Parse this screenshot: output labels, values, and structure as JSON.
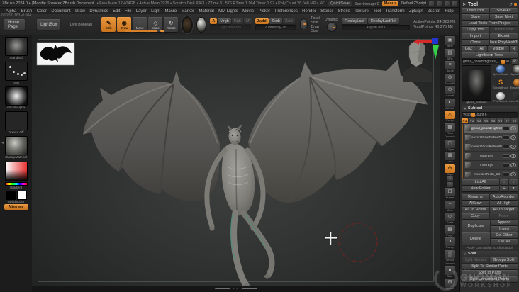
{
  "app": {
    "title": "ZBrush 2024.0.4 [Maddie Spencer]ZBrush Document",
    "stats": "• Free Mem 12.404GB • Active Mem 3979 • Scratch Disk 4363 • ZTime 51.576 RTime 1.964 Timer 1.97 • PolyCount 26.048 MP • MeshCount 5 Movie 180/57mb",
    "ac": "AC",
    "quicksave": "QuickSave",
    "see_through": "See-through 0",
    "menus_btn": "Menus",
    "zscript": "DefaultZScript"
  },
  "menu_bar": {
    "items": [
      "Alpha",
      "Brush",
      "Color",
      "Document",
      "Draw",
      "Dynamics",
      "Edit",
      "File",
      "Layer",
      "Light",
      "Macro",
      "Marker",
      "Material",
      "MM Lights",
      "Movie",
      "Picker",
      "Preferences",
      "Render",
      "Stencil",
      "Stroke",
      "Texture",
      "Tool",
      "Transform",
      "Zplugin",
      "Zscript",
      "Help"
    ]
  },
  "coords_readout": "0.928 0.163 -0.004",
  "top_shelf": {
    "home_page": "Home Page",
    "lightbox": "LightBox",
    "live_boolean": "Live Boolean",
    "modes": [
      {
        "label": "Edit",
        "glyph": "✎",
        "active": true
      },
      {
        "label": "Draw",
        "glyph": "◉",
        "active": true
      },
      {
        "label": "Move",
        "glyph": "+"
      },
      {
        "label": "Scale",
        "glyph": "◇"
      },
      {
        "label": "Rotate",
        "glyph": "↻"
      }
    ],
    "paint_buttons": [
      {
        "label": "A",
        "active": true
      },
      {
        "label": "Mrgb"
      },
      {
        "label": "Rgb",
        "dim": true
      },
      {
        "label": "M",
        "dim": true
      }
    ],
    "rgb_intensity": "Rgb Intensity",
    "sculpt_buttons": [
      {
        "label": "Zadd",
        "active": true
      },
      {
        "label": "Zsub"
      },
      {
        "label": "Zcut",
        "dim": true
      }
    ],
    "z_intensity": "Z Intensity 25",
    "focal_shift": "Focal Shift",
    "draw_size": "Draw Size",
    "dynamic_label": "Dynamic",
    "replay_last": "ReplayLast",
    "replay_last_rel": "ReplayLastRel",
    "adjust_last": "AdjustLast 1",
    "active_points": "ActivePoints: 24.323 Mil",
    "total_points": "TotalPoints: 46.275 Mil"
  },
  "left_shelf": {
    "items": [
      {
        "label": "Standard",
        "cls": "th-standard"
      },
      {
        "label": "Dots",
        "cls": "th-dots"
      },
      {
        "label": "xBrushAlpha",
        "cls": "th-alpha"
      },
      {
        "label": "Texture Off",
        "cls": "th-texture"
      },
      {
        "label": "StartupMaterial",
        "cls": "th-material"
      }
    ],
    "gradient_label": "Gradient",
    "switch_color": "SwitchColor",
    "alternate": "Alternate"
  },
  "right_shelf": {
    "items": [
      {
        "label": "BPR",
        "glyph": "▣"
      },
      {
        "label": "SPix",
        "glyph": "▤"
      },
      {
        "label": "Scroll",
        "glyph": "≡"
      },
      {
        "label": "Zoom3D",
        "glyph": "⊕"
      },
      {
        "label": "Actual",
        "glyph": "⊙"
      },
      {
        "label": "AAHalf",
        "glyph": "◐"
      },
      {
        "label": "Persp",
        "glyph": "△",
        "active": true
      },
      {
        "label": "Floor",
        "glyph": "▦"
      },
      {
        "label": "Dynamic",
        "glyph": "",
        "cls": "rs-label"
      },
      {
        "label": "L.Sym",
        "glyph": "◫"
      },
      {
        "label": "Lock",
        "glyph": "⊠"
      },
      {
        "label": "Gxyz",
        "glyph": "⊕",
        "active": true
      },
      {
        "label": "",
        "glyph": "○",
        "cls": "small"
      },
      {
        "label": "",
        "glyph": "○",
        "cls": "small"
      },
      {
        "label": "Frame",
        "glyph": "⊡"
      },
      {
        "label": "Move",
        "glyph": "+"
      },
      {
        "label": "Scale",
        "glyph": "◇"
      },
      {
        "label": "PolyF",
        "glyph": "▩"
      },
      {
        "label": "Transp",
        "glyph": "◑"
      },
      {
        "label": "Ghost",
        "glyph": "▒"
      },
      {
        "label": "Dynamic",
        "glyph": "",
        "cls": "rs-label"
      },
      {
        "label": "Solo",
        "glyph": "●"
      },
      {
        "label": "Xpose",
        "glyph": "⊟"
      }
    ]
  },
  "canvas": {
    "watermark": {
      "the": "THE",
      "line1": "GNOMON",
      "line2": "WORKSHOP"
    }
  },
  "tool_panel": {
    "title": "Tool",
    "row1": [
      {
        "label": "Load Tool"
      },
      {
        "label": "Save As"
      }
    ],
    "row2": [
      {
        "label": "Save"
      },
      {
        "label": "Save Next"
      }
    ],
    "row3": [
      {
        "label": "Load Tools From Project"
      }
    ],
    "row4": [
      {
        "label": "Copy Tool"
      },
      {
        "label": "Paste Tool",
        "dim": true
      }
    ],
    "row5": [
      {
        "label": "Import"
      },
      {
        "label": "Export"
      }
    ],
    "row6": [
      {
        "label": "Clone"
      },
      {
        "label": "Make PolyMesh3D"
      }
    ],
    "row7": [
      {
        "label": "GoZ",
        "cls": "c-goz"
      },
      {
        "label": "All",
        "cls": "c-all"
      },
      {
        "label": "Visible",
        "cls": "c-vis"
      },
      {
        "label": "R",
        "cls": "c-r"
      }
    ],
    "row8": [
      {
        "label": "Lightbox►Tools"
      }
    ],
    "tool_slider": {
      "label": "ghoul_posedHighres_",
      "value": "50",
      "r": "R"
    },
    "current_tool_label": "ghoul_posedH",
    "quick_tools": [
      {
        "label": "SphereBrush",
        "cls": "qt-sphere"
      },
      {
        "label": "AlphaBrush",
        "cls": "qt-alpha"
      },
      {
        "label": "SimpleBrush",
        "cls": "qt-simple"
      },
      {
        "label": "EraserBrush",
        "cls": "qt-eraser"
      },
      {
        "label": "PolySphere",
        "cls": "qt-poly"
      },
      {
        "label": "coverGhoulRe",
        "cls": "qt-cover"
      }
    ],
    "simple_brush_glyph": "S",
    "subtool": {
      "header": "Subtool",
      "visible_count": "Visible Count 6",
      "tabs": [
        {
          "label": "V1",
          "active": true
        },
        {
          "label": "V2"
        },
        {
          "label": "V3"
        },
        {
          "label": "V4"
        },
        {
          "label": "V5"
        },
        {
          "label": "V6"
        },
        {
          "label": "V7"
        },
        {
          "label": "V8"
        }
      ],
      "items": [
        {
          "name": "ghoul_posedHighres",
          "active": true
        },
        {
          "name": "coverGhoulRefinePasses_1"
        },
        {
          "name": "coverGhoulRefinePasses_0"
        },
        {
          "name": "outerEye"
        },
        {
          "name": "innerEye"
        },
        {
          "name": "monsterTeeth_13"
        }
      ],
      "list_all": "List All",
      "up_glyph": "↑",
      "down_glyph": "↓",
      "new_folder": "New Folder",
      "folder_add_glyph": "+",
      "folder_opt_glyph": "▾",
      "actions1": [
        {
          "label": "Rename"
        },
        {
          "label": "AutoReorder"
        }
      ],
      "actions2": [
        {
          "label": "All Low"
        },
        {
          "label": "All High"
        }
      ],
      "actions3": [
        {
          "label": "All To Home"
        },
        {
          "label": "All To Target"
        }
      ],
      "actions4": [
        {
          "label": "Copy"
        },
        {
          "label": "Paste",
          "dim": true
        }
      ],
      "duplicate": "Duplicate",
      "append": "Append",
      "insert": "Insert",
      "delete": "Delete",
      "del_other": "Del Other",
      "del_all": "Del All",
      "apply_last": "Apply Last Action To All Subtool"
    },
    "split": {
      "header": "Split",
      "rows1": [
        {
          "label": "Split Hidden",
          "dim": true
        },
        {
          "label": "Groups Split"
        }
      ],
      "rows2": [
        {
          "label": "Split To Similar Parts"
        }
      ],
      "rows3": [
        {
          "label": "Split To Parts"
        }
      ],
      "rows4": [
        {
          "label": "Split Unmasked Points"
        }
      ]
    }
  },
  "colors": {
    "accent": "#d9822b",
    "chrome": "#2d2d2d",
    "canvas_mid": "#3e4140"
  }
}
